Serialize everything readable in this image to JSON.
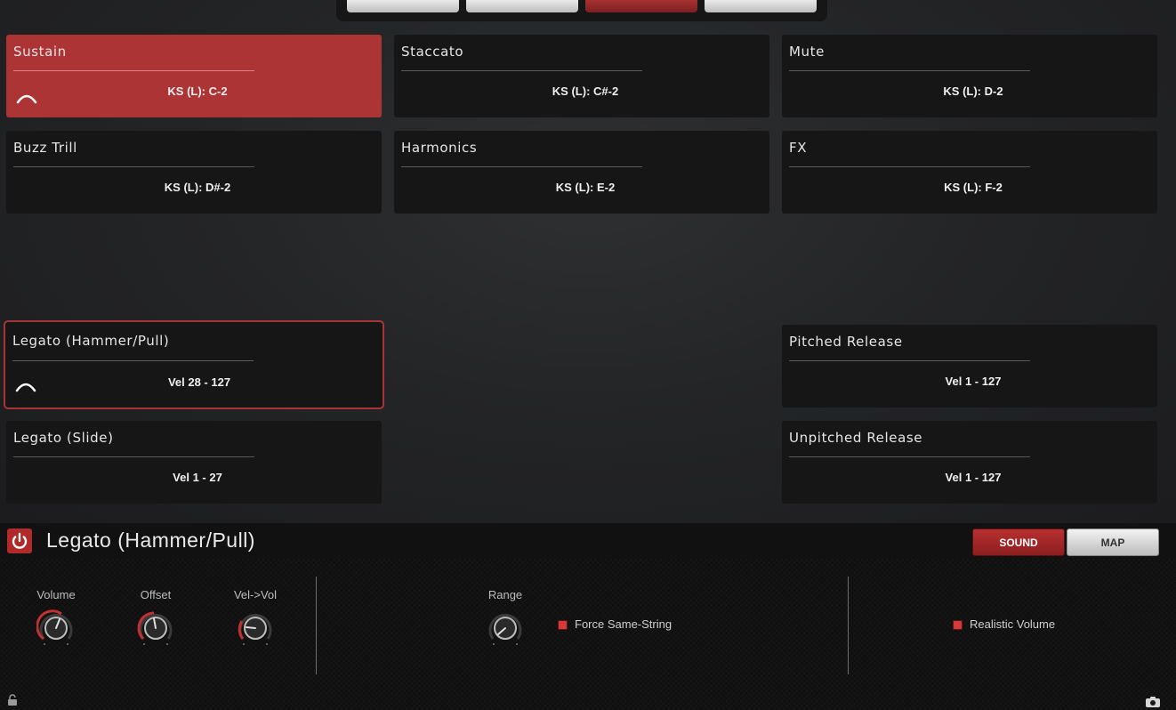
{
  "top_tabs": [
    {
      "name": "tab-1",
      "active": false
    },
    {
      "name": "tab-2",
      "active": false
    },
    {
      "name": "tab-3",
      "active": true
    },
    {
      "name": "tab-4",
      "active": false
    }
  ],
  "articulations": {
    "sustain": {
      "title": "Sustain",
      "info": "KS (L): C-2"
    },
    "staccato": {
      "title": "Staccato",
      "info": "KS (L): C#-2"
    },
    "mute": {
      "title": "Mute",
      "info": "KS (L): D-2"
    },
    "buzz_trill": {
      "title": "Buzz Trill",
      "info": "KS (L): D#-2"
    },
    "harmonics": {
      "title": "Harmonics",
      "info": "KS (L): E-2"
    },
    "fx": {
      "title": "FX",
      "info": "KS (L): F-2"
    },
    "legato_hammer": {
      "title": "Legato (Hammer/Pull)",
      "info": "Vel 28 - 127"
    },
    "legato_slide": {
      "title": "Legato (Slide)",
      "info": "Vel 1 - 27"
    },
    "pitched_release": {
      "title": "Pitched Release",
      "info": "Vel 1 - 127"
    },
    "unpitched_release": {
      "title": "Unpitched Release",
      "info": "Vel 1 - 127"
    }
  },
  "panel": {
    "title": "Legato (Hammer/Pull)",
    "sound_label": "SOUND",
    "map_label": "MAP",
    "active_view": "SOUND"
  },
  "controls": {
    "volume_label": "Volume",
    "offset_label": "Offset",
    "velvol_label": "Vel->Vol",
    "range_label": "Range",
    "force_same_string_label": "Force Same-String",
    "force_same_string_checked": true,
    "realistic_volume_label": "Realistic Volume",
    "realistic_volume_checked": true
  },
  "colors": {
    "accent_red": "#ad3434",
    "card_bg": "#161617",
    "checkbox_red": "#d43a3a"
  },
  "icons": {
    "power": "power-icon",
    "lock": "lock-icon",
    "camera": "camera-icon",
    "arc": "selected-arc-icon"
  }
}
